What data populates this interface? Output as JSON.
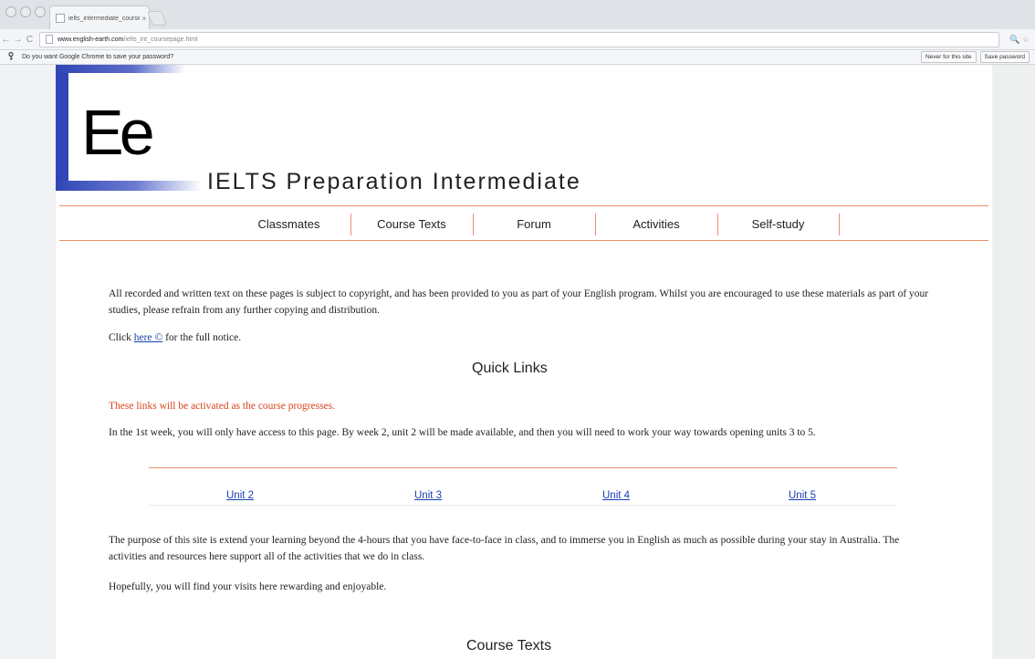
{
  "browser": {
    "tab_title": "ielts_intermediate_course...",
    "tab_close": "×",
    "nav_back": "←",
    "nav_forward": "→",
    "nav_reload": "C",
    "url_host": "www.english-earth.com",
    "url_path": "/ielts_int_coursepage.html",
    "addr_icons": "🔍 ☆"
  },
  "password_bar": {
    "message": "Do you want Google Chrome to save your password?",
    "never_label": "Never for this site",
    "save_label": "Save password"
  },
  "logo": {
    "text": "Ee"
  },
  "site": {
    "title": "IELTS Preparation Intermediate"
  },
  "nav": {
    "items": [
      {
        "label": "Classmates"
      },
      {
        "label": "Course Texts"
      },
      {
        "label": "Forum"
      },
      {
        "label": "Activities"
      },
      {
        "label": "Self-study"
      }
    ]
  },
  "notice": {
    "text": "All recorded and written text on these pages is subject to copyright, and has been provided to you as part of your English program. Whilst you are encouraged to use these materials as part of your studies, please refrain from any further copying and distribution.",
    "click_prefix": "Click",
    "click_link": "here ©",
    "click_suffix": "for the full notice."
  },
  "quick_links": {
    "heading": "Quick Links",
    "activation_note": "These links will be activated as the course progresses.",
    "week_info": "In the 1st week, you will only have access to this page. By week 2, unit 2 will be made available, and then you will need to work your way towards opening units 3 to 5.",
    "units": [
      {
        "label": "Unit 2"
      },
      {
        "label": "Unit 3"
      },
      {
        "label": "Unit 4"
      },
      {
        "label": "Unit 5"
      }
    ]
  },
  "purpose": {
    "text": "The purpose of this site is extend your learning beyond the 4-hours that you have face-to-face in class, and to immerse you in English as much as possible during your stay in Australia. The activities and resources here support all of the activities that we do in class.",
    "closing": "Hopefully, you will find your visits here rewarding and enjoyable."
  },
  "course_texts": {
    "heading": "Course Texts"
  }
}
